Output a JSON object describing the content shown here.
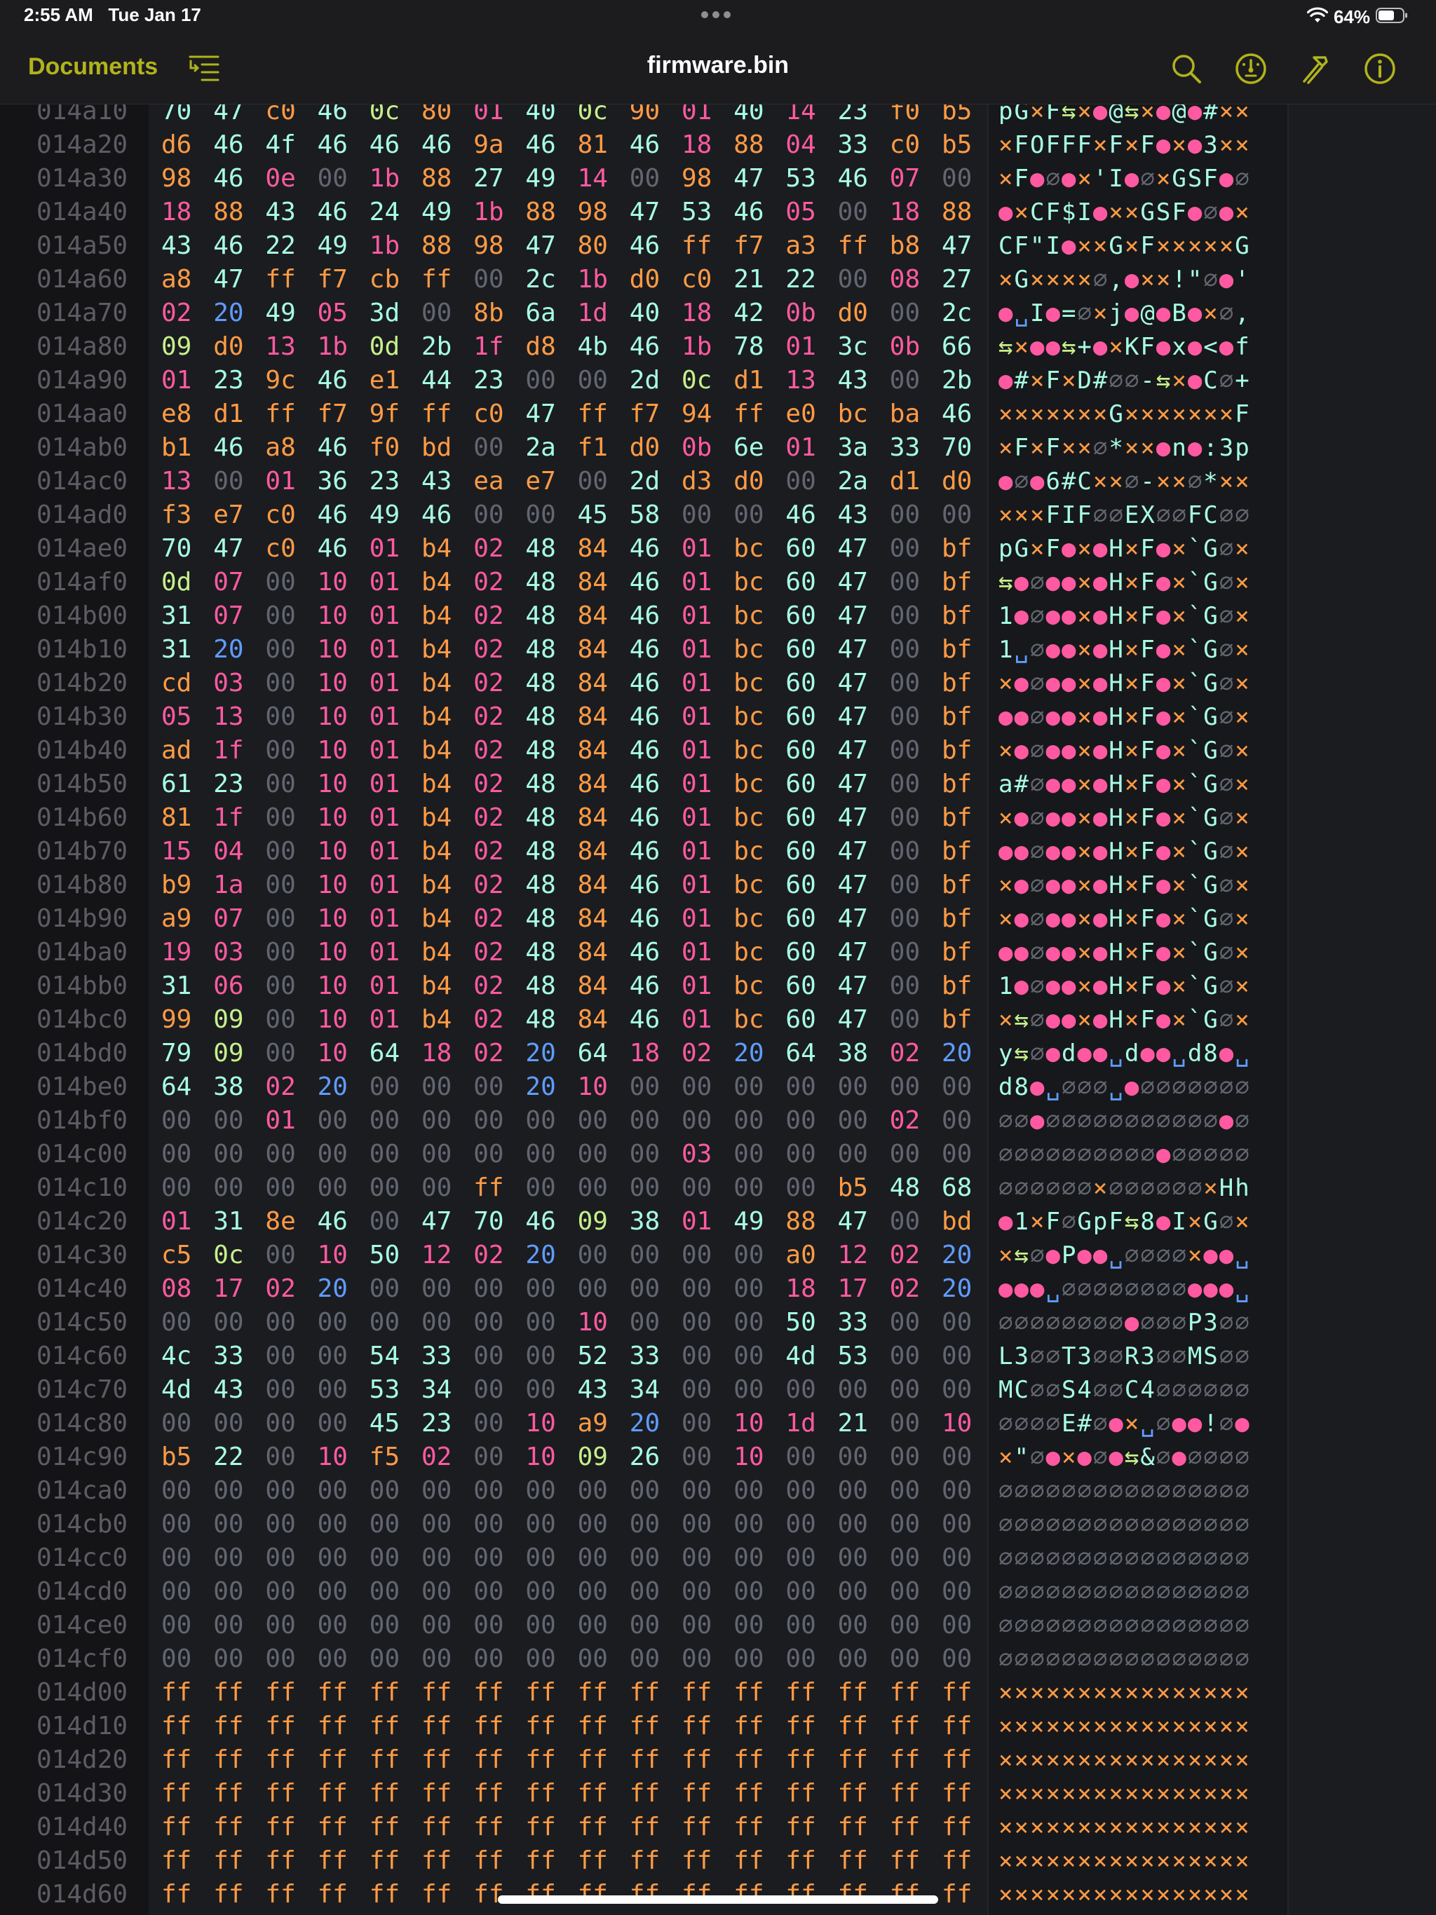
{
  "status_bar": {
    "time": "2:55 AM",
    "date": "Tue Jan 17",
    "battery": "64%",
    "icons": [
      "more-dots-icon",
      "wifi-icon",
      "battery-icon"
    ]
  },
  "nav": {
    "back_label": "Documents",
    "title": "firmware.bin",
    "icons": [
      "outline-list-icon",
      "search-icon",
      "inspector-gauge-icon",
      "hammer-tool-icon",
      "info-icon"
    ]
  },
  "colors": {
    "background": "#1b1c20",
    "accent": "#b1b31c",
    "zero": "#636670",
    "high": "#ff9b45",
    "control": "#ff5aa1",
    "whitespace": "#c6f08b",
    "space": "#5f9cff",
    "printable": "#a7ffe4"
  },
  "rows": [
    {
      "addr": "014a10",
      "hex": "70 47 c0 46 0c 80 01 40 0c 90 01 40 14 23 f0 b5"
    },
    {
      "addr": "014a20",
      "hex": "d6 46 4f 46 46 46 9a 46 81 46 18 88 04 33 c0 b5"
    },
    {
      "addr": "014a30",
      "hex": "98 46 0e 00 1b 88 27 49 14 00 98 47 53 46 07 00"
    },
    {
      "addr": "014a40",
      "hex": "18 88 43 46 24 49 1b 88 98 47 53 46 05 00 18 88"
    },
    {
      "addr": "014a50",
      "hex": "43 46 22 49 1b 88 98 47 80 46 ff f7 a3 ff b8 47"
    },
    {
      "addr": "014a60",
      "hex": "a8 47 ff f7 cb ff 00 2c 1b d0 c0 21 22 00 08 27"
    },
    {
      "addr": "014a70",
      "hex": "02 20 49 05 3d 00 8b 6a 1d 40 18 42 0b d0 00 2c"
    },
    {
      "addr": "014a80",
      "hex": "09 d0 13 1b 0d 2b 1f d8 4b 46 1b 78 01 3c 0b 66"
    },
    {
      "addr": "014a90",
      "hex": "01 23 9c 46 e1 44 23 00 00 2d 0c d1 13 43 00 2b"
    },
    {
      "addr": "014aa0",
      "hex": "e8 d1 ff f7 9f ff c0 47 ff f7 94 ff e0 bc ba 46"
    },
    {
      "addr": "014ab0",
      "hex": "b1 46 a8 46 f0 bd 00 2a f1 d0 0b 6e 01 3a 33 70"
    },
    {
      "addr": "014ac0",
      "hex": "13 00 01 36 23 43 ea e7 00 2d d3 d0 00 2a d1 d0"
    },
    {
      "addr": "014ad0",
      "hex": "f3 e7 c0 46 49 46 00 00 45 58 00 00 46 43 00 00"
    },
    {
      "addr": "014ae0",
      "hex": "70 47 c0 46 01 b4 02 48 84 46 01 bc 60 47 00 bf"
    },
    {
      "addr": "014af0",
      "hex": "0d 07 00 10 01 b4 02 48 84 46 01 bc 60 47 00 bf"
    },
    {
      "addr": "014b00",
      "hex": "31 07 00 10 01 b4 02 48 84 46 01 bc 60 47 00 bf"
    },
    {
      "addr": "014b10",
      "hex": "31 20 00 10 01 b4 02 48 84 46 01 bc 60 47 00 bf"
    },
    {
      "addr": "014b20",
      "hex": "cd 03 00 10 01 b4 02 48 84 46 01 bc 60 47 00 bf"
    },
    {
      "addr": "014b30",
      "hex": "05 13 00 10 01 b4 02 48 84 46 01 bc 60 47 00 bf"
    },
    {
      "addr": "014b40",
      "hex": "ad 1f 00 10 01 b4 02 48 84 46 01 bc 60 47 00 bf"
    },
    {
      "addr": "014b50",
      "hex": "61 23 00 10 01 b4 02 48 84 46 01 bc 60 47 00 bf"
    },
    {
      "addr": "014b60",
      "hex": "81 1f 00 10 01 b4 02 48 84 46 01 bc 60 47 00 bf"
    },
    {
      "addr": "014b70",
      "hex": "15 04 00 10 01 b4 02 48 84 46 01 bc 60 47 00 bf"
    },
    {
      "addr": "014b80",
      "hex": "b9 1a 00 10 01 b4 02 48 84 46 01 bc 60 47 00 bf"
    },
    {
      "addr": "014b90",
      "hex": "a9 07 00 10 01 b4 02 48 84 46 01 bc 60 47 00 bf"
    },
    {
      "addr": "014ba0",
      "hex": "19 03 00 10 01 b4 02 48 84 46 01 bc 60 47 00 bf"
    },
    {
      "addr": "014bb0",
      "hex": "31 06 00 10 01 b4 02 48 84 46 01 bc 60 47 00 bf"
    },
    {
      "addr": "014bc0",
      "hex": "99 09 00 10 01 b4 02 48 84 46 01 bc 60 47 00 bf"
    },
    {
      "addr": "014bd0",
      "hex": "79 09 00 10 64 18 02 20 64 18 02 20 64 38 02 20"
    },
    {
      "addr": "014be0",
      "hex": "64 38 02 20 00 00 00 20 10 00 00 00 00 00 00 00"
    },
    {
      "addr": "014bf0",
      "hex": "00 00 01 00 00 00 00 00 00 00 00 00 00 00 02 00"
    },
    {
      "addr": "014c00",
      "hex": "00 00 00 00 00 00 00 00 00 00 03 00 00 00 00 00"
    },
    {
      "addr": "014c10",
      "hex": "00 00 00 00 00 00 ff 00 00 00 00 00 00 b5 48 68"
    },
    {
      "addr": "014c20",
      "hex": "01 31 8e 46 00 47 70 46 09 38 01 49 88 47 00 bd"
    },
    {
      "addr": "014c30",
      "hex": "c5 0c 00 10 50 12 02 20 00 00 00 00 a0 12 02 20"
    },
    {
      "addr": "014c40",
      "hex": "08 17 02 20 00 00 00 00 00 00 00 00 18 17 02 20"
    },
    {
      "addr": "014c50",
      "hex": "00 00 00 00 00 00 00 00 10 00 00 00 50 33 00 00"
    },
    {
      "addr": "014c60",
      "hex": "4c 33 00 00 54 33 00 00 52 33 00 00 4d 53 00 00"
    },
    {
      "addr": "014c70",
      "hex": "4d 43 00 00 53 34 00 00 43 34 00 00 00 00 00 00"
    },
    {
      "addr": "014c80",
      "hex": "00 00 00 00 45 23 00 10 a9 20 00 10 1d 21 00 10"
    },
    {
      "addr": "014c90",
      "hex": "b5 22 00 10 f5 02 00 10 09 26 00 10 00 00 00 00"
    },
    {
      "addr": "014ca0",
      "hex": "00 00 00 00 00 00 00 00 00 00 00 00 00 00 00 00"
    },
    {
      "addr": "014cb0",
      "hex": "00 00 00 00 00 00 00 00 00 00 00 00 00 00 00 00"
    },
    {
      "addr": "014cc0",
      "hex": "00 00 00 00 00 00 00 00 00 00 00 00 00 00 00 00"
    },
    {
      "addr": "014cd0",
      "hex": "00 00 00 00 00 00 00 00 00 00 00 00 00 00 00 00"
    },
    {
      "addr": "014ce0",
      "hex": "00 00 00 00 00 00 00 00 00 00 00 00 00 00 00 00"
    },
    {
      "addr": "014cf0",
      "hex": "00 00 00 00 00 00 00 00 00 00 00 00 00 00 00 00"
    },
    {
      "addr": "014d00",
      "hex": "ff ff ff ff ff ff ff ff ff ff ff ff ff ff ff ff"
    },
    {
      "addr": "014d10",
      "hex": "ff ff ff ff ff ff ff ff ff ff ff ff ff ff ff ff"
    },
    {
      "addr": "014d20",
      "hex": "ff ff ff ff ff ff ff ff ff ff ff ff ff ff ff ff"
    },
    {
      "addr": "014d30",
      "hex": "ff ff ff ff ff ff ff ff ff ff ff ff ff ff ff ff"
    },
    {
      "addr": "014d40",
      "hex": "ff ff ff ff ff ff ff ff ff ff ff ff ff ff ff ff"
    },
    {
      "addr": "014d50",
      "hex": "ff ff ff ff ff ff ff ff ff ff ff ff ff ff ff ff"
    },
    {
      "addr": "014d60",
      "hex": "ff ff ff ff ff ff ff ff ff ff ff ff ff ff ff ff"
    }
  ]
}
